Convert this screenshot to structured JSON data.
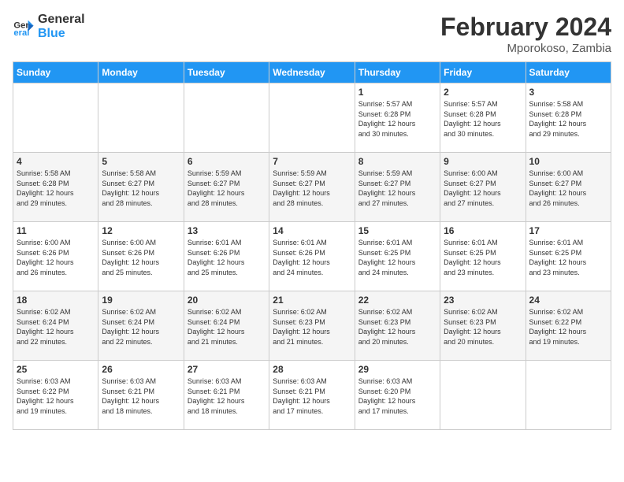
{
  "header": {
    "logo_line1": "General",
    "logo_line2": "Blue",
    "month_year": "February 2024",
    "location": "Mporokoso, Zambia"
  },
  "days_of_week": [
    "Sunday",
    "Monday",
    "Tuesday",
    "Wednesday",
    "Thursday",
    "Friday",
    "Saturday"
  ],
  "weeks": [
    [
      {
        "day": "",
        "content": ""
      },
      {
        "day": "",
        "content": ""
      },
      {
        "day": "",
        "content": ""
      },
      {
        "day": "",
        "content": ""
      },
      {
        "day": "1",
        "content": "Sunrise: 5:57 AM\nSunset: 6:28 PM\nDaylight: 12 hours\nand 30 minutes."
      },
      {
        "day": "2",
        "content": "Sunrise: 5:57 AM\nSunset: 6:28 PM\nDaylight: 12 hours\nand 30 minutes."
      },
      {
        "day": "3",
        "content": "Sunrise: 5:58 AM\nSunset: 6:28 PM\nDaylight: 12 hours\nand 29 minutes."
      }
    ],
    [
      {
        "day": "4",
        "content": "Sunrise: 5:58 AM\nSunset: 6:28 PM\nDaylight: 12 hours\nand 29 minutes."
      },
      {
        "day": "5",
        "content": "Sunrise: 5:58 AM\nSunset: 6:27 PM\nDaylight: 12 hours\nand 28 minutes."
      },
      {
        "day": "6",
        "content": "Sunrise: 5:59 AM\nSunset: 6:27 PM\nDaylight: 12 hours\nand 28 minutes."
      },
      {
        "day": "7",
        "content": "Sunrise: 5:59 AM\nSunset: 6:27 PM\nDaylight: 12 hours\nand 28 minutes."
      },
      {
        "day": "8",
        "content": "Sunrise: 5:59 AM\nSunset: 6:27 PM\nDaylight: 12 hours\nand 27 minutes."
      },
      {
        "day": "9",
        "content": "Sunrise: 6:00 AM\nSunset: 6:27 PM\nDaylight: 12 hours\nand 27 minutes."
      },
      {
        "day": "10",
        "content": "Sunrise: 6:00 AM\nSunset: 6:27 PM\nDaylight: 12 hours\nand 26 minutes."
      }
    ],
    [
      {
        "day": "11",
        "content": "Sunrise: 6:00 AM\nSunset: 6:26 PM\nDaylight: 12 hours\nand 26 minutes."
      },
      {
        "day": "12",
        "content": "Sunrise: 6:00 AM\nSunset: 6:26 PM\nDaylight: 12 hours\nand 25 minutes."
      },
      {
        "day": "13",
        "content": "Sunrise: 6:01 AM\nSunset: 6:26 PM\nDaylight: 12 hours\nand 25 minutes."
      },
      {
        "day": "14",
        "content": "Sunrise: 6:01 AM\nSunset: 6:26 PM\nDaylight: 12 hours\nand 24 minutes."
      },
      {
        "day": "15",
        "content": "Sunrise: 6:01 AM\nSunset: 6:25 PM\nDaylight: 12 hours\nand 24 minutes."
      },
      {
        "day": "16",
        "content": "Sunrise: 6:01 AM\nSunset: 6:25 PM\nDaylight: 12 hours\nand 23 minutes."
      },
      {
        "day": "17",
        "content": "Sunrise: 6:01 AM\nSunset: 6:25 PM\nDaylight: 12 hours\nand 23 minutes."
      }
    ],
    [
      {
        "day": "18",
        "content": "Sunrise: 6:02 AM\nSunset: 6:24 PM\nDaylight: 12 hours\nand 22 minutes."
      },
      {
        "day": "19",
        "content": "Sunrise: 6:02 AM\nSunset: 6:24 PM\nDaylight: 12 hours\nand 22 minutes."
      },
      {
        "day": "20",
        "content": "Sunrise: 6:02 AM\nSunset: 6:24 PM\nDaylight: 12 hours\nand 21 minutes."
      },
      {
        "day": "21",
        "content": "Sunrise: 6:02 AM\nSunset: 6:23 PM\nDaylight: 12 hours\nand 21 minutes."
      },
      {
        "day": "22",
        "content": "Sunrise: 6:02 AM\nSunset: 6:23 PM\nDaylight: 12 hours\nand 20 minutes."
      },
      {
        "day": "23",
        "content": "Sunrise: 6:02 AM\nSunset: 6:23 PM\nDaylight: 12 hours\nand 20 minutes."
      },
      {
        "day": "24",
        "content": "Sunrise: 6:02 AM\nSunset: 6:22 PM\nDaylight: 12 hours\nand 19 minutes."
      }
    ],
    [
      {
        "day": "25",
        "content": "Sunrise: 6:03 AM\nSunset: 6:22 PM\nDaylight: 12 hours\nand 19 minutes."
      },
      {
        "day": "26",
        "content": "Sunrise: 6:03 AM\nSunset: 6:21 PM\nDaylight: 12 hours\nand 18 minutes."
      },
      {
        "day": "27",
        "content": "Sunrise: 6:03 AM\nSunset: 6:21 PM\nDaylight: 12 hours\nand 18 minutes."
      },
      {
        "day": "28",
        "content": "Sunrise: 6:03 AM\nSunset: 6:21 PM\nDaylight: 12 hours\nand 17 minutes."
      },
      {
        "day": "29",
        "content": "Sunrise: 6:03 AM\nSunset: 6:20 PM\nDaylight: 12 hours\nand 17 minutes."
      },
      {
        "day": "",
        "content": ""
      },
      {
        "day": "",
        "content": ""
      }
    ]
  ]
}
